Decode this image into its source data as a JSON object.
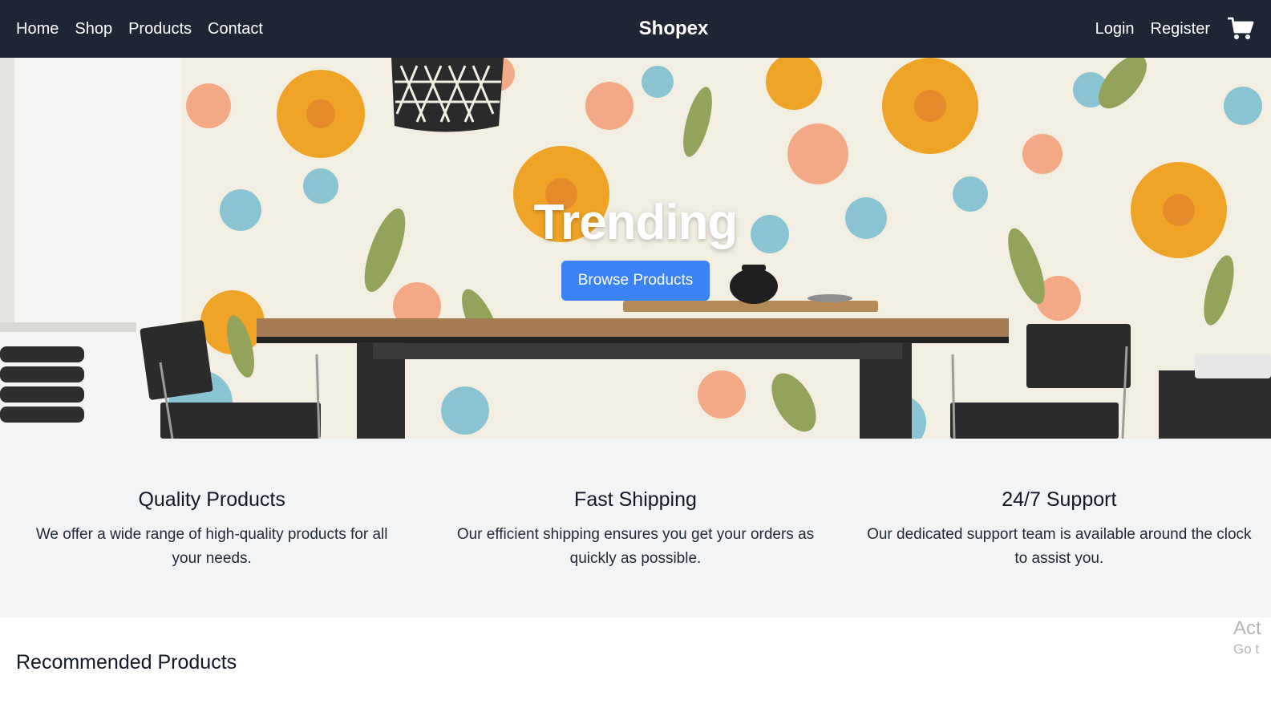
{
  "nav": {
    "links": [
      "Home",
      "Shop",
      "Products",
      "Contact"
    ],
    "brand": "Shopex",
    "login": "Login",
    "register": "Register",
    "cart_icon": "shopping-cart-icon"
  },
  "hero": {
    "title": "Trending",
    "button": "Browse Products"
  },
  "features": [
    {
      "title": "Quality Products",
      "text": "We offer a wide range of high-quality products for all your needs."
    },
    {
      "title": "Fast Shipping",
      "text": "Our efficient shipping ensures you get your orders as quickly as possible."
    },
    {
      "title": "24/7 Support",
      "text": "Our dedicated support team is available around the clock to assist you."
    }
  ],
  "recommended": {
    "title": "Recommended Products"
  },
  "watermark": {
    "line1": "Act",
    "line2": "Go t"
  },
  "colors": {
    "nav_bg": "#1e2636",
    "accent": "#3b82f6",
    "features_bg": "#f3f4f6"
  }
}
